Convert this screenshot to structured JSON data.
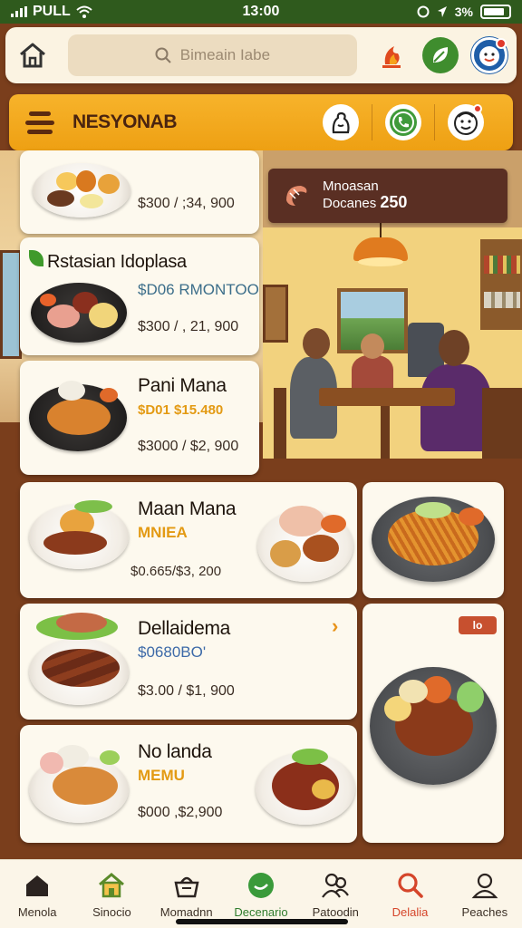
{
  "status_bar": {
    "carrier": "PULL",
    "time": "13:00",
    "battery": "3%"
  },
  "header": {
    "search_placeholder": "Bimeain Iabe"
  },
  "restaurant_bar": {
    "title": "NESYONAB"
  },
  "promo": {
    "title": "Mnoasan",
    "subtitle": "Docanes",
    "value": "250"
  },
  "cards": [
    {
      "title": "",
      "subtitle": "",
      "price": "$300 / ;34, 900"
    },
    {
      "title": "Rstasian Idoplasa",
      "subtitle": "$D06 RMONTOO",
      "price": "$300 / , 21, 900"
    },
    {
      "title": "Pani Mana",
      "subtitle": "$D01 $15.480",
      "price": "$3000 / $2, 900"
    },
    {
      "title": "Maan Mana",
      "subtitle": "MNIEA",
      "price": "$0.665/$3, 200"
    },
    {
      "title": "Dellaidema",
      "subtitle": "$0680BO'",
      "price": "$3.00 / $1, 900"
    },
    {
      "title": "No landa",
      "subtitle": "MEMU",
      "price": "$000 ,$2,900"
    }
  ],
  "side_tag": "lo",
  "colors": {
    "accent_orange": "#f2a91f",
    "status_bar_green": "#2f5a1d",
    "background_brown": "#7a3e1c"
  },
  "bottom_nav": [
    {
      "label": "Menola",
      "icon": "house-icon"
    },
    {
      "label": "Sinocio",
      "icon": "home-outline-icon"
    },
    {
      "label": "Momadnn",
      "icon": "basket-icon"
    },
    {
      "label": "Decenario",
      "icon": "chat-icon"
    },
    {
      "label": "Patoodin",
      "icon": "people-icon"
    },
    {
      "label": "Delalia",
      "icon": "search-icon"
    },
    {
      "label": "Peaches",
      "icon": "person-icon"
    }
  ]
}
